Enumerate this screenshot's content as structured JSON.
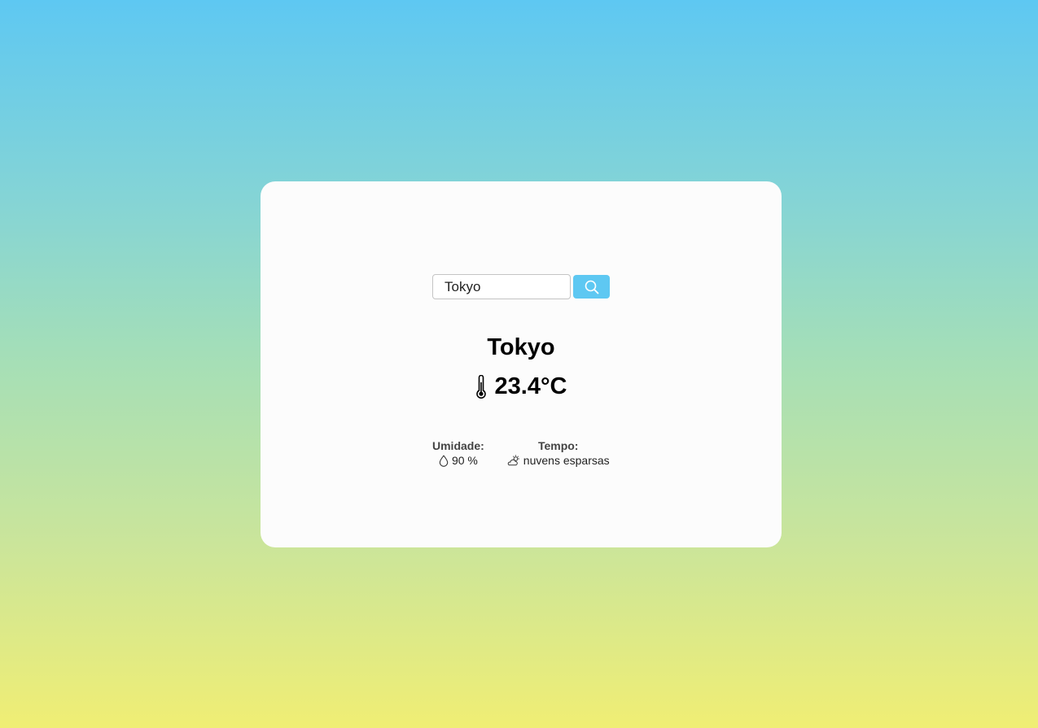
{
  "search": {
    "value": "Tokyo",
    "icon": "search-icon"
  },
  "weather": {
    "city": "Tokyo",
    "temperature": "23.4°C",
    "temperature_icon": "thermometer-icon"
  },
  "details": {
    "humidity": {
      "label": "Umidade:",
      "value": "90 %",
      "icon": "droplet-icon"
    },
    "condition": {
      "label": "Tempo:",
      "value": "nuvens esparsas",
      "icon": "cloud-sun-icon"
    }
  },
  "colors": {
    "accent": "#5ec8f2",
    "card": "#fcfcfc",
    "gradient_top": "#5ec8f2",
    "gradient_bottom": "#f0ee74"
  }
}
